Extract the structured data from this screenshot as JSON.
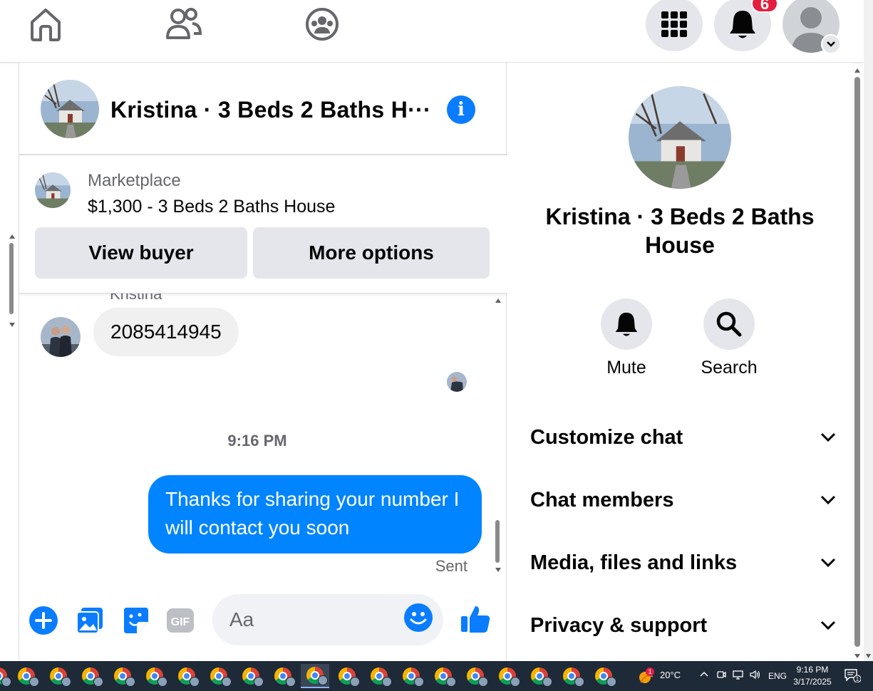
{
  "topnav": {
    "notifications_count": "6"
  },
  "chat": {
    "title": "Kristina · 3 Beds 2 Baths H···",
    "marketplace": {
      "label": "Marketplace",
      "listing": "$1,300 - 3 Beds 2 Baths House",
      "view_buyer": "View buyer",
      "more_options": "More options"
    },
    "messages": {
      "sender_name": "Kristina",
      "incoming_text": "2085414945",
      "timestamp": "9:16 PM",
      "outgoing_text": "Thanks for sharing your number I will contact you soon",
      "status": "Sent"
    },
    "composer": {
      "placeholder": "Aa",
      "gif_label": "GIF"
    }
  },
  "info_panel": {
    "name": "Kristina · 3 Beds 2 Baths House",
    "actions": {
      "mute": "Mute",
      "search": "Search"
    },
    "sections": [
      {
        "label": "Customize chat"
      },
      {
        "label": "Chat members"
      },
      {
        "label": "Media, files and links"
      },
      {
        "label": "Privacy & support"
      }
    ]
  },
  "taskbar": {
    "weather_badge": "1",
    "temperature": "20°C",
    "language": "ENG",
    "time": "9:16 PM",
    "date": "3/17/2025",
    "notification_count": "1"
  },
  "colors": {
    "messenger_blue": "#0084ff",
    "info_blue": "#0a7cff",
    "badge_red": "#e41e3f",
    "button_gray": "#e4e6eb"
  }
}
